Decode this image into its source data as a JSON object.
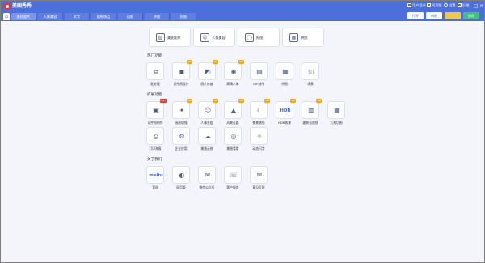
{
  "app": {
    "title": "美图秀秀"
  },
  "titlebar": {
    "items": [
      {
        "icon": "user-icon",
        "label": "用户登录"
      },
      {
        "icon": "web-icon",
        "label": "网页版"
      },
      {
        "icon": "settings-icon",
        "label": "设置"
      },
      {
        "icon": "feedback-icon",
        "label": "反馈"
      }
    ],
    "window_buttons": [
      {
        "icon": "minimize-icon",
        "glyph": "—"
      },
      {
        "icon": "maximize-icon",
        "glyph": "□"
      },
      {
        "icon": "close-icon",
        "glyph": "×"
      }
    ]
  },
  "tabs": [
    "美化图片",
    "人像美容",
    "文字",
    "贴纸饰品",
    "边框",
    "拼图",
    "抠图"
  ],
  "active_tab": 0,
  "toolbar": {
    "open": "打开",
    "new": "新建",
    "save_alt": "",
    "save": "保存"
  },
  "big_cards": [
    {
      "icon": "image-icon",
      "label": "美化图片"
    },
    {
      "icon": "portrait-icon",
      "label": "人像美容"
    },
    {
      "icon": "cutout-icon",
      "label": "抠图"
    },
    {
      "icon": "collage-icon",
      "label": "拼图"
    }
  ],
  "sections": [
    {
      "title": "热门功能",
      "items": [
        {
          "label": "批处理",
          "icon": "batch-icon",
          "badge": ""
        },
        {
          "label": "证件照设计",
          "icon": "id-photo-icon",
          "badge": "VIP"
        },
        {
          "label": "照片修复",
          "icon": "photo-repair-icon",
          "badge": "VIP"
        },
        {
          "label": "高清人像",
          "icon": "hd-portrait-icon",
          "badge": "VIP"
        },
        {
          "label": "GIF制作",
          "icon": "gif-icon",
          "badge": ""
        },
        {
          "label": "拼图",
          "icon": "collage-icon",
          "badge": ""
        },
        {
          "label": "场景",
          "icon": "scene-icon",
          "badge": ""
        }
      ]
    },
    {
      "title": "扩展功能",
      "items": [
        {
          "label": "证件照制作",
          "icon": "id-photo-make-icon",
          "badge": "HOT"
        },
        {
          "label": "画质增强",
          "icon": "enhance-icon",
          "badge": "VIP"
        },
        {
          "label": "人像去痘",
          "icon": "acne-icon",
          "badge": "VIP"
        },
        {
          "label": "风景去路",
          "icon": "landscape-icon",
          "badge": "VIP"
        },
        {
          "label": "夜景增强",
          "icon": "night-icon",
          "badge": "VIP"
        },
        {
          "label": "HDR效果",
          "icon": "hdr-icon",
          "glyph": "HDR",
          "badge": "VIP"
        },
        {
          "label": "建筑去透视",
          "icon": "building-icon",
          "badge": "VIP"
        },
        {
          "label": "九格切图",
          "icon": "grid-icon",
          "badge": ""
        },
        {
          "label": "打印海报",
          "icon": "print-icon",
          "badge": ""
        },
        {
          "label": "企业应用",
          "icon": "enterprise-icon",
          "badge": ""
        },
        {
          "label": "美图云修",
          "icon": "cloud-icon",
          "badge": ""
        },
        {
          "label": "美图看看",
          "icon": "viewer-icon",
          "badge": ""
        },
        {
          "label": "动态闪字",
          "icon": "sparkle-icon",
          "badge": ""
        }
      ]
    },
    {
      "title": "关于我们",
      "items": [
        {
          "label": "官网",
          "icon": "meitu-logo-icon",
          "glyph": "meitu",
          "badge": ""
        },
        {
          "label": "网页版",
          "icon": "web-version-icon",
          "badge": ""
        },
        {
          "label": "微信公众号",
          "icon": "wechat-icon",
          "badge": ""
        },
        {
          "label": "客户服务",
          "icon": "phone-icon",
          "badge": ""
        },
        {
          "label": "意见反馈",
          "icon": "mail-icon",
          "badge": ""
        }
      ]
    }
  ],
  "colors": {
    "brand_blue": "#4d6fdb",
    "badge_vip": "#f5a623",
    "badge_hot": "#e23b36"
  }
}
